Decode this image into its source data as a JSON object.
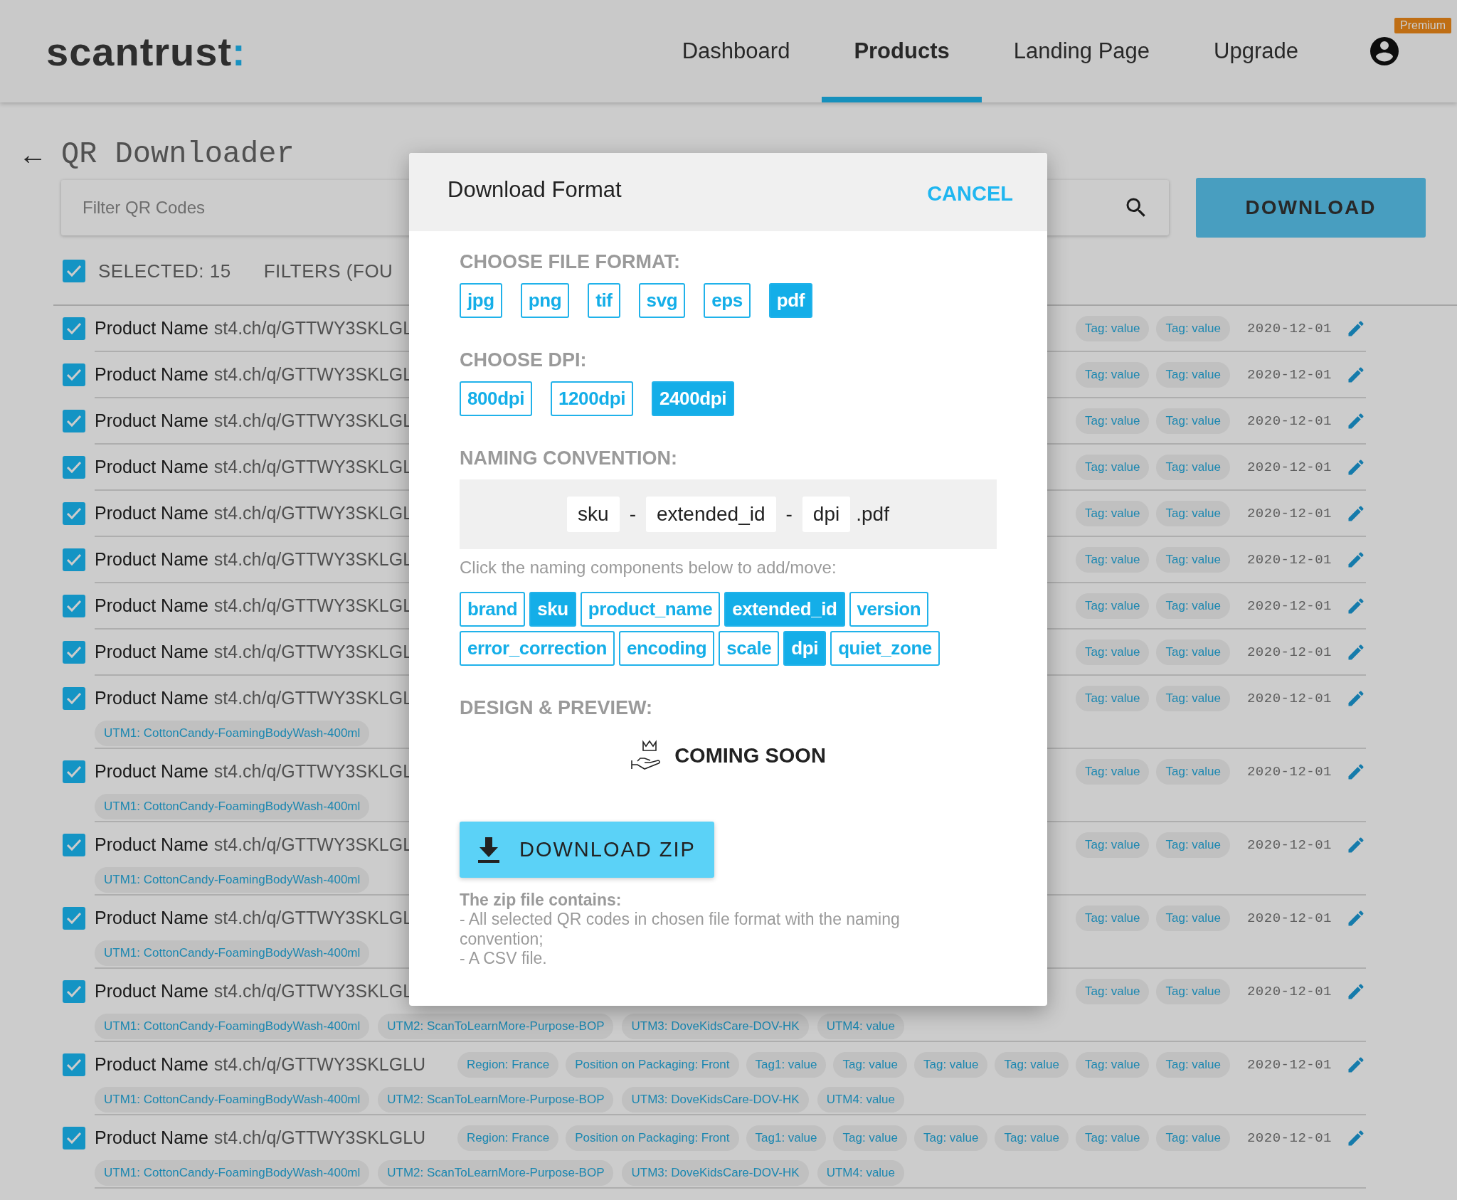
{
  "header": {
    "logo": "scantrust",
    "logo_mark": ":",
    "nav": [
      {
        "label": "Dashboard",
        "selected": false
      },
      {
        "label": "Products",
        "selected": true
      },
      {
        "label": "Landing Page",
        "selected": false
      },
      {
        "label": "Upgrade",
        "selected": false
      }
    ],
    "badge": "Premium"
  },
  "page": {
    "back": "←",
    "title": "QR Downloader",
    "filter": {
      "placeholder": "Filter QR Codes"
    },
    "download": "DOWNLOAD",
    "selection": {
      "checked": true,
      "label": "SELECTED: 15",
      "filters": "FILTERS (FOU"
    }
  },
  "rows": [
    {
      "checked": true,
      "name": "Product Name",
      "url": "st4.ch/q/GTTWY3SKLGL",
      "tags": [
        "Tag: value",
        "Tag: value"
      ],
      "date": "2020-12-01",
      "utms": []
    },
    {
      "checked": true,
      "name": "Product Name",
      "url": "st4.ch/q/GTTWY3SKLGL",
      "tags": [
        "Tag: value",
        "Tag: value"
      ],
      "date": "2020-12-01",
      "utms": []
    },
    {
      "checked": true,
      "name": "Product Name",
      "url": "st4.ch/q/GTTWY3SKLGL",
      "tags": [
        "Tag: value",
        "Tag: value"
      ],
      "date": "2020-12-01",
      "utms": []
    },
    {
      "checked": true,
      "name": "Product Name",
      "url": "st4.ch/q/GTTWY3SKLGL",
      "tags": [
        "Tag: value",
        "Tag: value"
      ],
      "date": "2020-12-01",
      "utms": []
    },
    {
      "checked": true,
      "name": "Product Name",
      "url": "st4.ch/q/GTTWY3SKLGL",
      "tags": [
        "Tag: value",
        "Tag: value"
      ],
      "date": "2020-12-01",
      "utms": []
    },
    {
      "checked": true,
      "name": "Product Name",
      "url": "st4.ch/q/GTTWY3SKLGL",
      "tags": [
        "Tag: value",
        "Tag: value"
      ],
      "date": "2020-12-01",
      "utms": []
    },
    {
      "checked": true,
      "name": "Product Name",
      "url": "st4.ch/q/GTTWY3SKLGL",
      "tags": [
        "Tag: value",
        "Tag: value"
      ],
      "date": "2020-12-01",
      "utms": []
    },
    {
      "checked": true,
      "name": "Product Name",
      "url": "st4.ch/q/GTTWY3SKLGL",
      "tags": [
        "Tag: value",
        "Tag: value"
      ],
      "date": "2020-12-01",
      "utms": []
    },
    {
      "checked": true,
      "name": "Product Name",
      "url": "st4.ch/q/GTTWY3SKLGL",
      "tags": [
        "Tag: value",
        "Tag: value"
      ],
      "date": "2020-12-01",
      "utms": [
        "UTM1: CottonCandy-FoamingBodyWash-400ml"
      ]
    },
    {
      "checked": true,
      "name": "Product Name",
      "url": "st4.ch/q/GTTWY3SKLGL",
      "tags": [
        "Tag: value",
        "Tag: value"
      ],
      "date": "2020-12-01",
      "utms": [
        "UTM1: CottonCandy-FoamingBodyWash-400ml"
      ]
    },
    {
      "checked": true,
      "name": "Product Name",
      "url": "st4.ch/q/GTTWY3SKLGL",
      "tags": [
        "Tag: value",
        "Tag: value"
      ],
      "date": "2020-12-01",
      "utms": [
        "UTM1: CottonCandy-FoamingBodyWash-400ml"
      ]
    },
    {
      "checked": true,
      "name": "Product Name",
      "url": "st4.ch/q/GTTWY3SKLGL",
      "tags": [
        "Tag: value",
        "Tag: value"
      ],
      "date": "2020-12-01",
      "utms": [
        "UTM1: CottonCandy-FoamingBodyWash-400ml"
      ]
    },
    {
      "checked": true,
      "name": "Product Name",
      "url": "st4.ch/q/GTTWY3SKLGL",
      "tags": [
        "Tag: value",
        "Tag: value"
      ],
      "date": "2020-12-01",
      "utms": [
        "UTM1: CottonCandy-FoamingBodyWash-400ml",
        "UTM2: ScanToLearnMore-Purpose-BOP",
        "UTM3: DoveKidsCare-DOV-HK",
        "UTM4: value"
      ]
    },
    {
      "checked": true,
      "name": "Product Name",
      "url": "st4.ch/q/GTTWY3SKLGLU",
      "tags": [
        "Region: France",
        "Position on Packaging: Front",
        "Tag1: value",
        "Tag: value",
        "Tag: value",
        "Tag: value",
        "Tag: value",
        "Tag: value"
      ],
      "date": "2020-12-01",
      "utms": [
        "UTM1: CottonCandy-FoamingBodyWash-400ml",
        "UTM2: ScanToLearnMore-Purpose-BOP",
        "UTM3: DoveKidsCare-DOV-HK",
        "UTM4: value"
      ]
    },
    {
      "checked": true,
      "name": "Product Name",
      "url": "st4.ch/q/GTTWY3SKLGLU",
      "tags": [
        "Region: France",
        "Position on Packaging: Front",
        "Tag1: value",
        "Tag: value",
        "Tag: value",
        "Tag: value",
        "Tag: value",
        "Tag: value"
      ],
      "date": "2020-12-01",
      "utms": [
        "UTM1: CottonCandy-FoamingBodyWash-400ml",
        "UTM2: ScanToLearnMore-Purpose-BOP",
        "UTM3: DoveKidsCare-DOV-HK",
        "UTM4: value"
      ]
    }
  ],
  "dialog": {
    "title": "Download Format",
    "cancel": "CANCEL",
    "formats": {
      "label": "CHOOSE FILE FORMAT:",
      "options": [
        {
          "label": "jpg",
          "selected": false
        },
        {
          "label": "png",
          "selected": false
        },
        {
          "label": "tif",
          "selected": false
        },
        {
          "label": "svg",
          "selected": false
        },
        {
          "label": "eps",
          "selected": false
        },
        {
          "label": "pdf",
          "selected": true
        }
      ]
    },
    "dpi": {
      "label": "CHOOSE DPI:",
      "options": [
        {
          "label": "800dpi",
          "selected": false
        },
        {
          "label": "1200dpi",
          "selected": false
        },
        {
          "label": "2400dpi",
          "selected": true
        }
      ]
    },
    "naming": {
      "label": "NAMING CONVENTION:",
      "parts": [
        {
          "kind": "part",
          "text": "sku"
        },
        {
          "kind": "separator",
          "text": "-"
        },
        {
          "kind": "part",
          "text": "extended_id"
        },
        {
          "kind": "separator",
          "text": "-"
        },
        {
          "kind": "part",
          "text": "dpi"
        },
        {
          "kind": "extension",
          "text": ".pdf"
        }
      ],
      "hint": "Click the naming components below to add/move:",
      "components": [
        {
          "label": "brand",
          "selected": false
        },
        {
          "label": "sku",
          "selected": true
        },
        {
          "label": "product_name",
          "selected": false
        },
        {
          "label": "extended_id",
          "selected": true
        },
        {
          "label": "version",
          "selected": false
        },
        {
          "label": "error_correction",
          "selected": false
        },
        {
          "label": "encoding",
          "selected": false
        },
        {
          "label": "scale",
          "selected": false
        },
        {
          "label": "dpi",
          "selected": true
        },
        {
          "label": "quiet_zone",
          "selected": false
        }
      ]
    },
    "design": {
      "label": "DESIGN & PREVIEW:",
      "coming_soon": "COMING SOON"
    },
    "zip_button": "DOWNLOAD ZIP",
    "zip_info": {
      "title": "The zip file contains:",
      "lines": [
        "- All selected QR codes in chosen file format with the naming convention;",
        "- A CSV file."
      ]
    }
  }
}
